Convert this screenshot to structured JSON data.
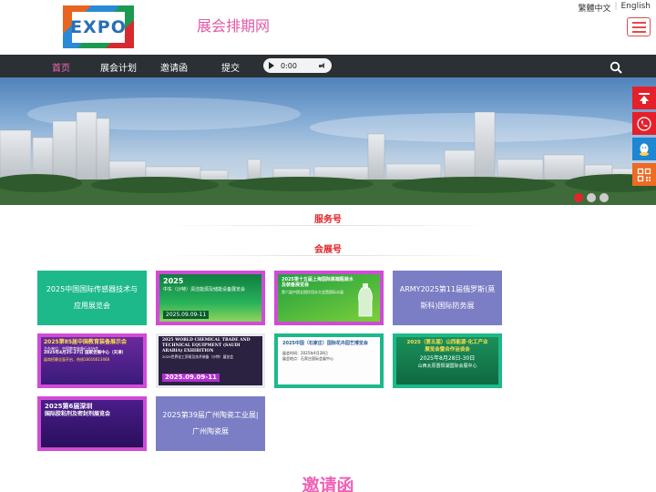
{
  "header": {
    "site_name": "展会排期网",
    "logo_text": "EXPO",
    "lang_traditional": "繁體中文",
    "lang_english": "English"
  },
  "nav": {
    "items": [
      "首页",
      "展会计划",
      "邀请函",
      "提交"
    ],
    "active_index": 0,
    "audio_time": "0:00"
  },
  "sections": {
    "service_account": "服务号",
    "expo_account": "会展号",
    "invitation": "邀请函"
  },
  "cards": [
    {
      "text": "2025中国国际传感器技术与应用展览会"
    },
    {
      "lines": [
        "2025",
        "中东（沙特）清洁能源及储能设备展览会",
        "2025.09.09-11"
      ]
    },
    {
      "lines": [
        "2025第十五届上海国际高端瓶装水及装备展览会",
        "第六届中国全国饮用水大会暨国际水展"
      ]
    },
    {
      "text": "ARMY2025第11届俄罗斯(莫斯科)国际防务展"
    },
    {
      "lines": [
        "2025第85届中国教育装备展示会",
        "主办单位：中国教育装备行业协会",
        "2025年4月25-27日 国家会展中心（天津）",
        "展商招募全面开启，热线18016613468"
      ]
    },
    {
      "lines": [
        "2025 WORLD CHEMICAL TRADE AND",
        "TECHNICAL EQUIPMENT (SAUDI",
        "ARABIA) EXHIBITION",
        "2025世界化工贸易及技术装备（沙特）展览会",
        "2025.09.09-11"
      ]
    },
    {
      "lines": [
        "2025中国（石家庄）国际花卉园艺博览会",
        "展会时间：2025年4月28日",
        "展会地点：石家庄国际会展中心"
      ]
    },
    {
      "lines": [
        "2025（第五届）山西能源·化工产业",
        "展览会暨合作治谈会",
        "2025年8月28日-30日",
        "山西太原晋阳湖国际会展中心"
      ]
    },
    {
      "lines": [
        "2025第6届深圳",
        "国际胶粘剂及密封剂展览会"
      ]
    },
    {
      "text": "2025第39届广州陶瓷工业展|广州陶瓷展"
    }
  ],
  "colors": {
    "accent_pink": "#f062b5",
    "red": "#e0262a",
    "nav_bg": "#2b3034",
    "card_green": "#1db98a",
    "card_purple": "#7b7ec4",
    "card_frame_magenta": "#d04bd6"
  },
  "side_tools": [
    "back-to-top-icon",
    "phone-icon",
    "qq-icon",
    "qr-code-icon"
  ]
}
